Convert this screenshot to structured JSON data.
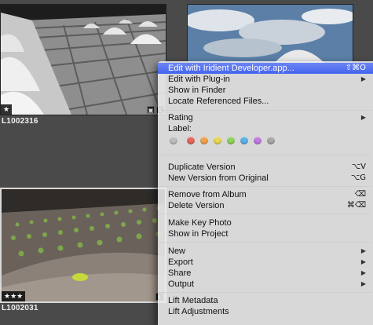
{
  "thumbnails": [
    {
      "caption": "L1002316",
      "stars": "★",
      "badges": [
        "▣",
        "↯"
      ]
    },
    {
      "caption": "",
      "stars": "",
      "badges": []
    },
    {
      "caption": "L1002031",
      "stars": "★★★",
      "badges": [
        "↯"
      ]
    }
  ],
  "menu": {
    "items": [
      {
        "label": "Edit with Iridient Developer.app...",
        "shortcut": "⇧⌘O",
        "highlighted": true
      },
      {
        "label": "Edit with Plug-in",
        "submenu": true
      },
      {
        "label": "Show in Finder"
      },
      {
        "label": "Locate Referenced Files..."
      },
      {
        "label": "Rating",
        "submenu": true
      },
      {
        "label": "Label:"
      },
      {
        "label": "Duplicate Version",
        "shortcut": "⌥V"
      },
      {
        "label": "New Version from Original",
        "shortcut": "⌥G"
      },
      {
        "label": "Remove from Album",
        "shortcut": "⌫"
      },
      {
        "label": "Delete Version",
        "shortcut": "⌘⌫"
      },
      {
        "label": "Make Key Photo"
      },
      {
        "label": "Show in Project"
      },
      {
        "label": "New",
        "submenu": true
      },
      {
        "label": "Export",
        "submenu": true
      },
      {
        "label": "Share",
        "submenu": true
      },
      {
        "label": "Output",
        "submenu": true
      },
      {
        "label": "Lift Metadata"
      },
      {
        "label": "Lift Adjustments"
      }
    ],
    "submenu_arrow": "▶",
    "label_colors": [
      {
        "name": "none",
        "color": "#bdbdbd"
      },
      {
        "name": "red",
        "color": "#e8665e"
      },
      {
        "name": "orange",
        "color": "#f2a24a"
      },
      {
        "name": "yellow",
        "color": "#e9d84d"
      },
      {
        "name": "green",
        "color": "#8fd45a"
      },
      {
        "name": "blue",
        "color": "#5ab1ea"
      },
      {
        "name": "purple",
        "color": "#c27be0"
      },
      {
        "name": "gray",
        "color": "#a9a9a9"
      }
    ],
    "highlight_color": "#4a6cf0"
  }
}
